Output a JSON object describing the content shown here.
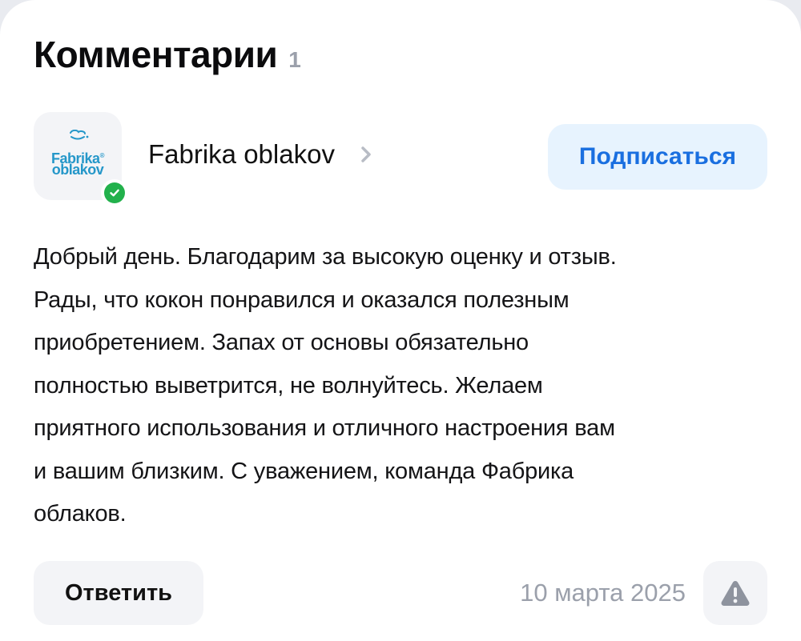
{
  "header": {
    "title": "Комментарии",
    "count": "1"
  },
  "author": {
    "name": "Fabrika oblakov",
    "logo_line1": "Fabrika",
    "logo_line2": "oblakov",
    "logo_reg": "®",
    "verified": true,
    "subscribe_label": "Подписаться"
  },
  "comment": {
    "text": "Добрый день. Благодарим за высокую оценку и отзыв.\nРады, что кокон понравился и оказался полезным\nприобретением. Запах от основы обязательно\nполностью выветрится, не волнуйтесь. Желаем\nприятного использования и отличного настроения вам\nи вашим близким. С уважением, команда Фабрика\nоблаков."
  },
  "footer": {
    "reply_label": "Ответить",
    "date": "10 марта 2025"
  },
  "icons": {
    "chevron": "chevron-right-icon",
    "verified": "check-circle-icon",
    "report": "warning-triangle-icon"
  },
  "colors": {
    "accent": "#1a6fe0",
    "subscribe_bg": "#e7f3fe",
    "verified_green": "#22b14c",
    "muted_text": "#9ba0ab",
    "logo_blue": "#2597c9",
    "button_bg": "#f3f4f7"
  }
}
